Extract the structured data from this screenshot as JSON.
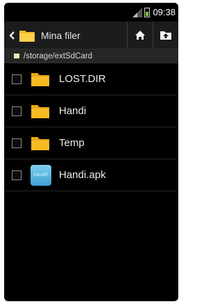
{
  "status_bar": {
    "time": "09:38"
  },
  "action_bar": {
    "title": "Mina filer",
    "back_icon": "chevron-left-icon",
    "home_icon": "home-icon",
    "up_icon": "folder-up-icon"
  },
  "path_bar": {
    "path": "/storage/extSdCard"
  },
  "files": [
    {
      "name": "LOST.DIR",
      "icon": "folder-icon",
      "checked": false
    },
    {
      "name": "Handi",
      "icon": "folder-icon",
      "checked": false
    },
    {
      "name": "Temp",
      "icon": "folder-icon",
      "checked": false
    },
    {
      "name": "Handi.apk",
      "icon": "apk-icon",
      "icon_text": "HandiPl",
      "checked": false
    }
  ],
  "colors": {
    "folder": "#f6bb23",
    "accent_battery": "#6ccf2c",
    "background": "#000000"
  }
}
